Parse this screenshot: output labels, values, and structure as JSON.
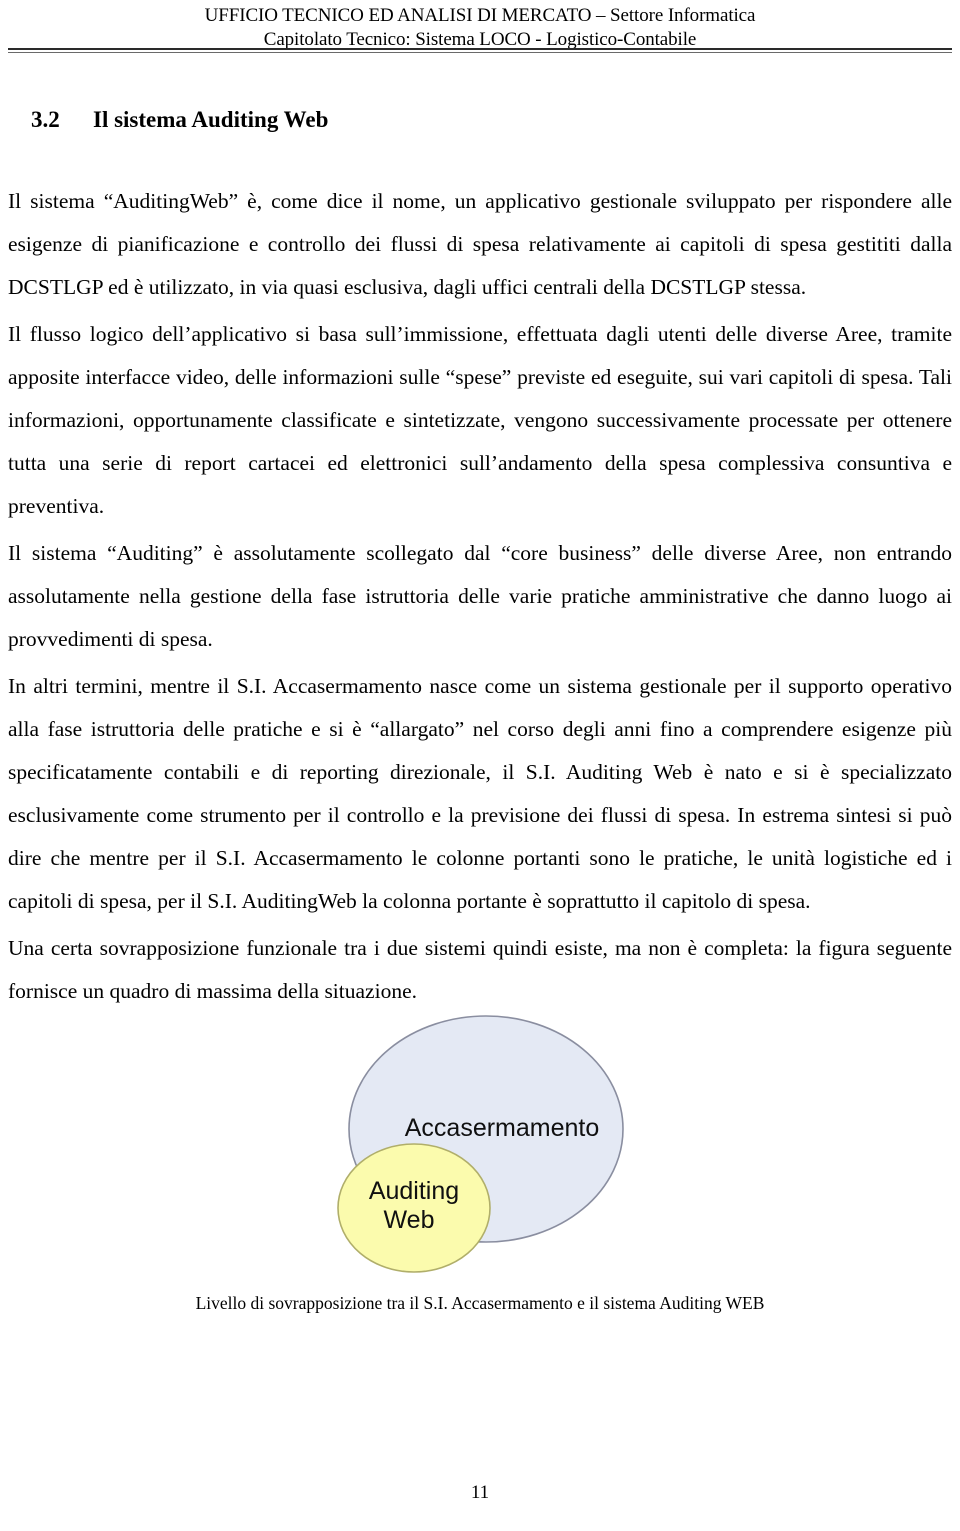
{
  "header": {
    "line1": "UFFICIO TECNICO ED ANALISI DI MERCATO – Settore Informatica",
    "line2": "Capitolato Tecnico: Sistema LOCO - Logistico-Contabile"
  },
  "section": {
    "number": "3.2",
    "title": "Il sistema Auditing Web"
  },
  "paragraphs": [
    "Il sistema “AuditingWeb” è, come dice il nome, un applicativo gestionale sviluppato per rispondere alle esigenze di pianificazione e controllo dei flussi di spesa relativamente ai capitoli di spesa gestititi dalla DCSTLGP ed è utilizzato, in via quasi esclusiva, dagli uffici centrali della DCSTLGP stessa.",
    "Il flusso logico dell’applicativo si basa sull’immissione, effettuata dagli utenti delle diverse Aree, tramite apposite interfacce video, delle informazioni sulle “spese” previste ed eseguite, sui vari capitoli di spesa. Tali informazioni, opportunamente classificate e sintetizzate, vengono successivamente processate per ottenere tutta una serie di report cartacei ed elettronici sull’andamento della spesa complessiva consuntiva e preventiva.",
    "Il sistema “Auditing” è assolutamente scollegato dal “core business” delle diverse Aree, non entrando assolutamente nella gestione della fase istruttoria delle varie pratiche amministrative che danno luogo ai provvedimenti di spesa.",
    "In altri termini, mentre il S.I. Accasermamento nasce come un sistema gestionale per il supporto operativo alla fase istruttoria delle pratiche e si è “allargato” nel corso degli anni fino a comprendere esigenze più specificatamente contabili e di reporting direzionale, il S.I. Auditing Web è nato e si è specializzato esclusivamente come strumento per il controllo e la previsione dei flussi di spesa. In estrema sintesi si può dire che mentre per il S.I. Accasermamento le colonne portanti sono le pratiche, le unità logistiche ed i capitoli di spesa, per il S.I. AuditingWeb la colonna portante è soprattutto il capitolo di spesa.",
    "Una certa sovrapposizione funzionale tra i due sistemi quindi esiste, ma non è completa: la figura seguente fornisce un quadro di massima della situazione."
  ],
  "figure": {
    "large_set_label": "Accasermamento",
    "small_set_label_line1": "Auditing",
    "small_set_label_line2": "Web",
    "caption": "Livello di sovrapposizione tra il S.I. Accasermamento e il sistema Auditing WEB",
    "colors": {
      "large_set_fill": "#e4e9f4",
      "large_set_stroke": "#8a8ea0",
      "small_set_fill": "#fbfbad",
      "small_set_stroke": "#b0ae6a",
      "label_color": "#101010"
    }
  },
  "footer": {
    "page_number": "11"
  }
}
